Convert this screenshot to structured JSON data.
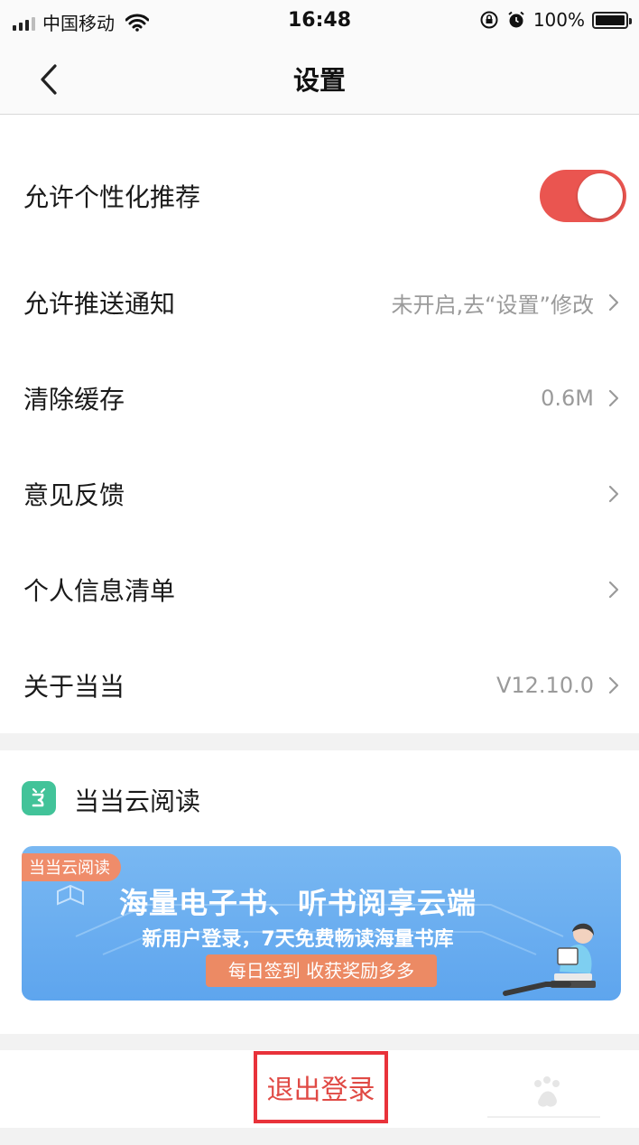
{
  "status_bar": {
    "carrier": "中国移动",
    "time": "16:48",
    "battery": "100%",
    "battery_level": 1.0
  },
  "header": {
    "title": "设置"
  },
  "settings": {
    "rows": [
      {
        "label": "允许个性化推荐",
        "value": "",
        "toggle_on": true
      },
      {
        "label": "允许推送通知",
        "value": "未开启,去“设置”修改"
      },
      {
        "label": "清除缓存",
        "value": "0.6M"
      },
      {
        "label": "意见反馈",
        "value": ""
      },
      {
        "label": "个人信息清单",
        "value": ""
      },
      {
        "label": "关于当当",
        "value": "V12.10.0"
      }
    ]
  },
  "cloud_reading": {
    "title": "当当云阅读",
    "banner": {
      "tag": "当当云阅读",
      "headline": "海量电子书、听书阅享云端",
      "subline": "新用户登录，7天免费畅读海量书库",
      "cta": "每日签到 收获奖励多多"
    }
  },
  "logout": {
    "label": "退出登录"
  },
  "colors": {
    "accent": "#ea5550",
    "highlight_border": "#e8323a",
    "cloud_green": "#42c399",
    "banner_blue": "#6aaef0"
  }
}
